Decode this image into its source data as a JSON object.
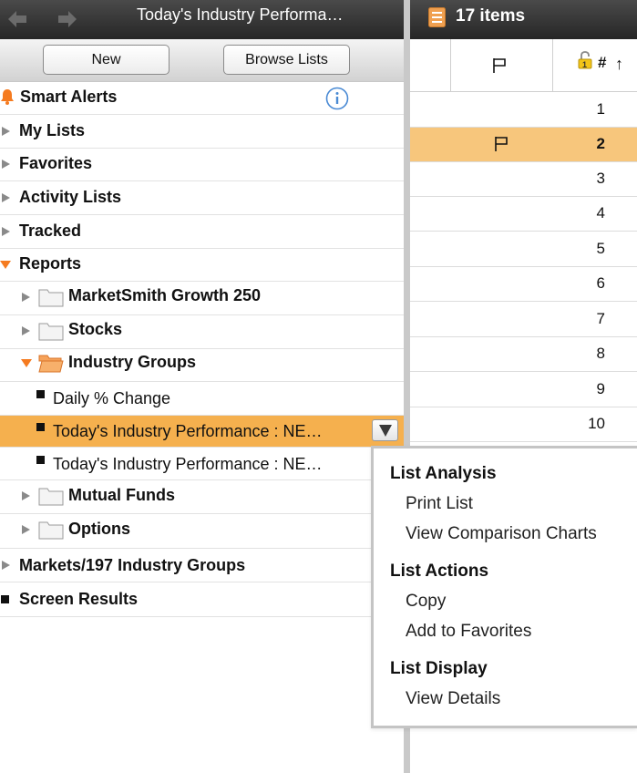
{
  "window": {
    "title": "Today's Industry Performa…"
  },
  "toolbar": {
    "new_label": "New",
    "browse_label": "Browse Lists"
  },
  "sidebar": {
    "smart_alerts": "Smart Alerts",
    "my_lists": "My Lists",
    "favorites": "Favorites",
    "activity_lists": "Activity Lists",
    "tracked": "Tracked",
    "reports": "Reports",
    "marketsmith_growth": "MarketSmith Growth 250",
    "stocks": "Stocks",
    "industry_groups": "Industry Groups",
    "daily_change": "Daily % Change",
    "todays_perf_1": "Today's Industry Performance : NE…",
    "todays_perf_2": "Today's Industry Performance : NE…",
    "mutual_funds": "Mutual Funds",
    "options": "Options",
    "markets_197": "Markets/197 Industry Groups",
    "screen_results": "Screen Results"
  },
  "right_panel": {
    "items_count": "17 items",
    "column_number": "#",
    "sort_arrow": "↑",
    "rows": [
      "1",
      "2",
      "3",
      "4",
      "5",
      "6",
      "7",
      "8",
      "9",
      "10"
    ],
    "flagged_row": "2"
  },
  "context_menu": {
    "section_analysis": "List Analysis",
    "print_list": "Print List",
    "view_comparison": "View Comparison Charts",
    "section_actions": "List Actions",
    "copy": "Copy",
    "add_favorites": "Add to Favorites",
    "section_display": "List Display",
    "view_details": "View Details"
  },
  "colors": {
    "accent_orange": "#f5b04e",
    "row_selected": "#f7c67c",
    "info_blue": "#4a8ad4",
    "triangle_orange": "#f57b20"
  },
  "icons": [
    "back-arrow-icon",
    "forward-arrow-icon",
    "bell-icon",
    "info-icon",
    "folder-icon",
    "folder-open-icon",
    "flag-icon",
    "lock-icon",
    "list-icon",
    "dropdown-icon"
  ]
}
